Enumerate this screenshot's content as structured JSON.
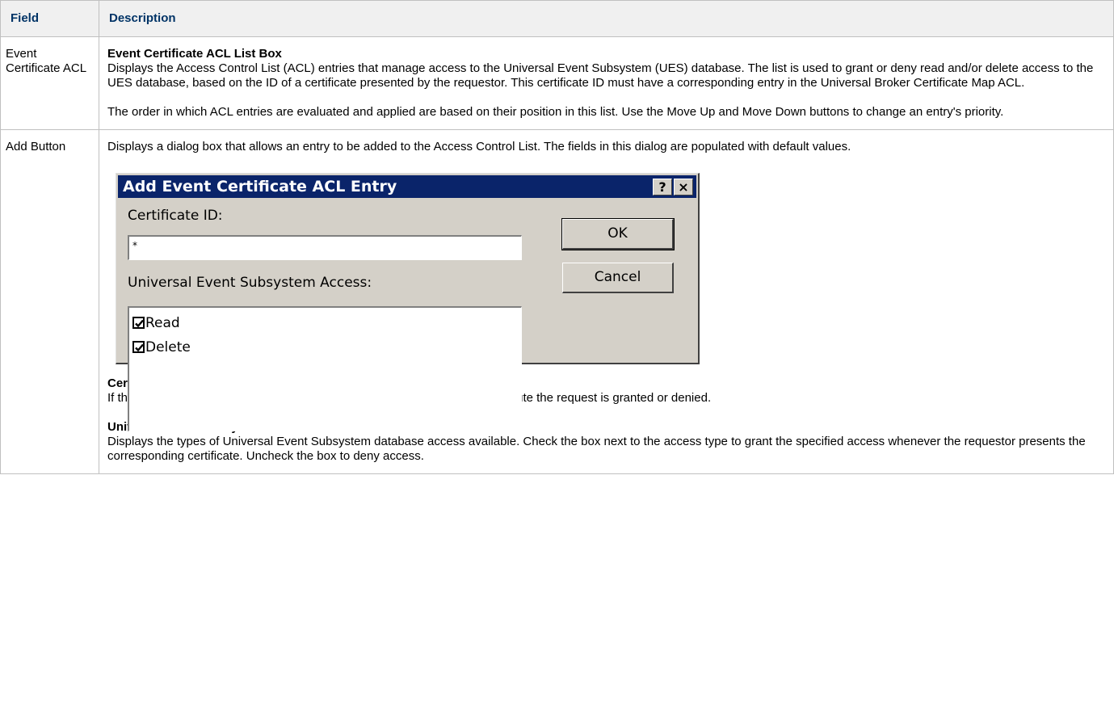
{
  "table": {
    "header_field": "Field",
    "header_description": "Description"
  },
  "rows": [
    {
      "field": "Event Certificate ACL",
      "title": "Event Certificate ACL List Box",
      "para1": "Displays the Access Control List (ACL) entries that manage access to the Universal Event Subsystem (UES) database. The list is used to grant or deny read and/or delete access to the UES database, based on the ID of a certificate presented by the requestor. This certificate ID must have a corresponding entry in the Universal Broker Certificate Map ACL.",
      "para2": "The order in which ACL entries are evaluated and applied are based on their position in this list. Use the Move Up and Move Down buttons to change an entry's priority."
    },
    {
      "field": "Add Button",
      "intro": "Displays a dialog box that allows an entry to be added to the Access Control List. The fields in this dialog are populated with default values.",
      "dialog": {
        "title": "Add Event Certificate ACL Entry",
        "help_button": "?",
        "close_button": "×",
        "certificate_id_label": "Certificate ID:",
        "certificate_id_value": "*",
        "access_label": "Universal Event Subsystem Access:",
        "access_items": [
          {
            "label": "Read",
            "checked": true
          },
          {
            "label": "Delete",
            "checked": true
          }
        ],
        "ok_label": "OK",
        "cancel_label": "Cancel"
      },
      "cert_id_heading": "Certificate ID",
      "cert_id_text": "If the value entered here is listed in the Certificate Map, the authority to execute the request is granted or denied.",
      "ues_heading": "Universal Event Subsystem Access",
      "ues_text": "Displays the types of Universal Event Subsystem database access available. Check the box next to the access type to grant the specified access whenever the requestor presents the corresponding certificate. Uncheck the box to deny access."
    }
  ]
}
